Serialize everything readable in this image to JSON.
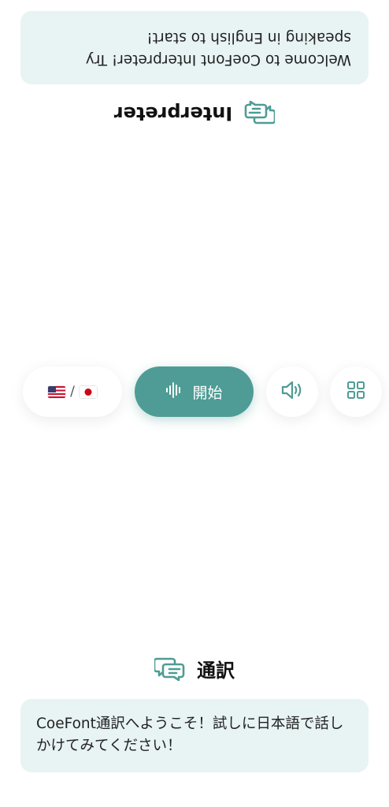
{
  "top_panel": {
    "title": "Interpreter",
    "message": "Welcome to CoeFont Interpreter! Try speaking in English to start!"
  },
  "controls": {
    "language_separator": "/",
    "start_label": "開始"
  },
  "bottom_panel": {
    "title": "通訳",
    "message": "CoeFont通訳へようこそ！試しに日本語で話しかけてみてください！"
  },
  "colors": {
    "accent": "#4e9c95",
    "bubble_bg": "#e8f3f3"
  },
  "icons": {
    "title": "chat-bubbles-icon",
    "start": "waveform-icon",
    "speaker": "speaker-icon",
    "menu": "grid-icon"
  }
}
